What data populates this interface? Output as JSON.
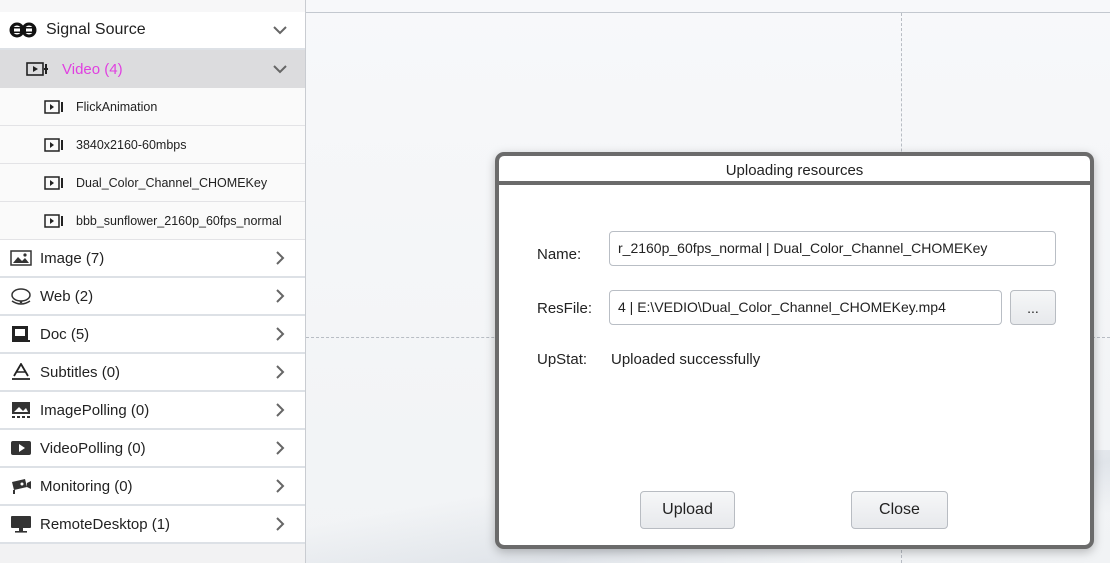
{
  "sidebar": {
    "source": {
      "label": "Signal Source",
      "icon": "signal-source-icon"
    },
    "video": {
      "label": "Video (4)",
      "color": "#e040e0",
      "icon": "video-icon"
    },
    "files": [
      {
        "label": "FlickAnimation"
      },
      {
        "label": "3840x2160-60mbps"
      },
      {
        "label": "Dual_Color_Channel_CHOMEKey"
      },
      {
        "label": "bbb_sunflower_2160p_60fps_normal"
      }
    ],
    "categories": [
      {
        "label": "Image (7)",
        "icon": "image-icon"
      },
      {
        "label": "Web (2)",
        "icon": "web-icon"
      },
      {
        "label": "Doc (5)",
        "icon": "doc-icon"
      },
      {
        "label": "Subtitles (0)",
        "icon": "subtitles-icon"
      },
      {
        "label": "ImagePolling (0)",
        "icon": "image-polling-icon"
      },
      {
        "label": "VideoPolling (0)",
        "icon": "video-polling-icon"
      },
      {
        "label": "Monitoring (0)",
        "icon": "monitoring-icon"
      },
      {
        "label": "RemoteDesktop (1)",
        "icon": "remote-desktop-icon"
      }
    ]
  },
  "dialog": {
    "title": "Uploading resources",
    "name_label": "Name:",
    "name_value": "r_2160p_60fps_normal | Dual_Color_Channel_CHOMEKey",
    "resfile_label": "ResFile:",
    "resfile_value": "4 | E:\\VEDIO\\Dual_Color_Channel_CHOMEKey.mp4",
    "browse_label": "...",
    "upstat_label": "UpStat:",
    "upstat_value": "Uploaded successfully",
    "upload_label": "Upload",
    "close_label": "Close"
  }
}
